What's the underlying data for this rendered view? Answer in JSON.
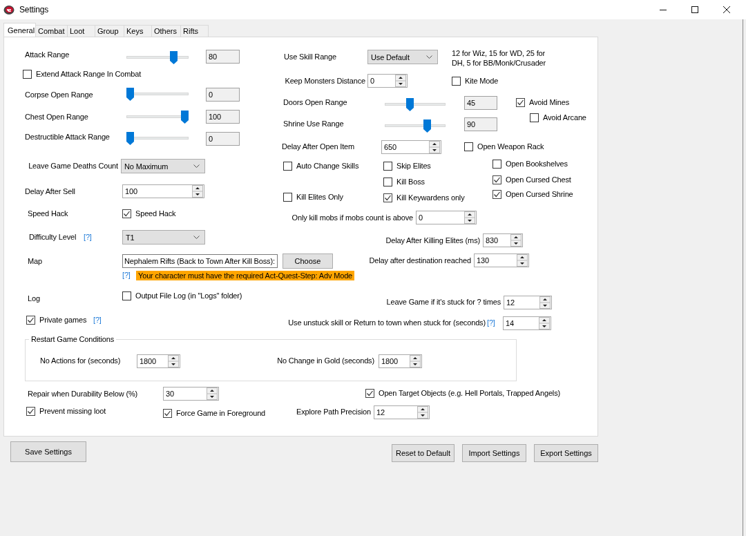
{
  "window": {
    "title": "Settings"
  },
  "tabs": [
    {
      "label": "General",
      "selected": true
    },
    {
      "label": "Combat",
      "selected": false
    },
    {
      "label": "Loot",
      "selected": false
    },
    {
      "label": "Group",
      "selected": false
    },
    {
      "label": "Keys",
      "selected": false
    },
    {
      "label": "Others",
      "selected": false
    },
    {
      "label": "Rifts",
      "selected": false
    }
  ],
  "left_controls": [
    {
      "kind": "label",
      "text": "Attack Range"
    },
    {
      "kind": "slider",
      "level": 0.8
    },
    {
      "kind": "readout",
      "value": "80"
    },
    {
      "kind": "checkbox",
      "label": "Extend Attack Range In Combat",
      "checked": false
    },
    {
      "kind": "label",
      "text": "Corpse Open Range"
    },
    {
      "kind": "slider",
      "level": 0
    },
    {
      "kind": "readout",
      "value": "0"
    },
    {
      "kind": "label",
      "text": "Chest Open Range"
    },
    {
      "kind": "slider",
      "level": 1
    },
    {
      "kind": "readout",
      "value": "100"
    },
    {
      "kind": "label",
      "text": "Destructible Attack Range"
    },
    {
      "kind": "slider",
      "level": 0
    },
    {
      "kind": "readout",
      "value": "0"
    },
    {
      "kind": "label",
      "text": "Leave Game Deaths Count"
    },
    {
      "kind": "dropdown",
      "value": "No Maximum"
    },
    {
      "kind": "label",
      "text": "Delay After Sell"
    },
    {
      "kind": "spin",
      "value": "100"
    },
    {
      "kind": "label",
      "text": "Speed Hack"
    },
    {
      "kind": "checkbox",
      "label": "Speed Hack",
      "checked": true
    },
    {
      "kind": "label",
      "text": "Difficulty Level"
    },
    {
      "kind": "help",
      "text": "[?]"
    },
    {
      "kind": "dropdown",
      "value": "T1"
    },
    {
      "kind": "label",
      "text": "Map"
    },
    {
      "kind": "textbox",
      "value": "Nephalem Rifts (Back to Town After Kill Boss):"
    },
    {
      "kind": "button",
      "label": "Choose"
    },
    {
      "kind": "help",
      "text": "[?]"
    },
    {
      "kind": "warning",
      "text": "Your character must have the required Act-Quest-Step: Adv Mode"
    },
    {
      "kind": "label",
      "text": "Log"
    },
    {
      "kind": "checkbox",
      "label": "Output File Log (in \"Logs\" folder)",
      "checked": false
    },
    {
      "kind": "checkbox",
      "label": "Private games",
      "checked": true
    },
    {
      "kind": "help",
      "text": "[?]"
    }
  ],
  "right_controls": [
    {
      "kind": "label",
      "text": "Use Skill Range"
    },
    {
      "kind": "dropdown",
      "value": "Use Default"
    },
    {
      "kind": "label",
      "text": "12 for Wiz, 15 for WD, 25 for DH,  5 for BB/Monk/Crusader"
    },
    {
      "kind": "label",
      "text": "Keep Monsters Distance"
    },
    {
      "kind": "spin",
      "value": "0"
    },
    {
      "kind": "checkbox",
      "label": "Kite Mode",
      "checked": false
    },
    {
      "kind": "label",
      "text": "Doors Open Range"
    },
    {
      "kind": "slider",
      "level": 0.4
    },
    {
      "kind": "readout",
      "value": "45"
    },
    {
      "kind": "checkbox",
      "label": "Avoid Mines",
      "checked": true
    },
    {
      "kind": "label",
      "text": "Shrine Use Range"
    },
    {
      "kind": "slider",
      "level": 0.73
    },
    {
      "kind": "readout",
      "value": "90"
    },
    {
      "kind": "checkbox",
      "label": "Avoid Arcane",
      "checked": false
    },
    {
      "kind": "label",
      "text": "Delay After Open Item"
    },
    {
      "kind": "spin",
      "value": "650"
    },
    {
      "kind": "checkbox",
      "label": "Open Weapon Rack",
      "checked": false
    },
    {
      "kind": "checkbox",
      "label": "Auto Change Skills",
      "checked": false
    },
    {
      "kind": "checkbox",
      "label": "Skip Elites",
      "checked": false
    },
    {
      "kind": "checkbox",
      "label": "Open Bookshelves",
      "checked": false
    },
    {
      "kind": "checkbox",
      "label": "Kill Boss",
      "checked": false
    },
    {
      "kind": "checkbox",
      "label": "Open Cursed Chest",
      "checked": true
    },
    {
      "kind": "checkbox",
      "label": "Kill Elites Only",
      "checked": false
    },
    {
      "kind": "checkbox",
      "label": "Kill Keywardens only",
      "checked": true
    },
    {
      "kind": "checkbox",
      "label": "Open Cursed Shrine",
      "checked": true
    },
    {
      "kind": "label",
      "text": "Only kill mobs if mobs count is above"
    },
    {
      "kind": "spin",
      "value": "0"
    },
    {
      "kind": "label",
      "text": "Delay After Killing Elites (ms)"
    },
    {
      "kind": "spin",
      "value": "830"
    },
    {
      "kind": "label",
      "text": "Delay after destination reached"
    },
    {
      "kind": "spin",
      "value": "130"
    },
    {
      "kind": "label",
      "text": "Leave Game if it's stuck for ? times"
    },
    {
      "kind": "spin",
      "value": "12"
    },
    {
      "kind": "label",
      "text": "Use unstuck skill or Return to town when stuck for (seconds)"
    },
    {
      "kind": "help",
      "text": "[?]"
    },
    {
      "kind": "spin",
      "value": "14"
    }
  ],
  "restart_group": {
    "kind": "group",
    "title": "Restart Game Conditions",
    "controls": [
      {
        "kind": "label",
        "text": "No Actions for (seconds)"
      },
      {
        "kind": "spin",
        "value": "1800"
      },
      {
        "kind": "label",
        "text": "No Change in Gold (seconds)"
      },
      {
        "kind": "spin",
        "value": "1800"
      }
    ]
  },
  "bottom_controls": [
    {
      "kind": "label",
      "text": "Repair when Durability Below (%)"
    },
    {
      "kind": "spin",
      "value": "30"
    },
    {
      "kind": "checkbox",
      "label": "Open Target Objects (e.g. Hell Portals, Trapped Angels)",
      "checked": true
    },
    {
      "kind": "checkbox",
      "label": "Prevent missing loot",
      "checked": true
    },
    {
      "kind": "checkbox",
      "label": "Force Game in Foreground",
      "checked": true
    },
    {
      "kind": "label",
      "text": "Explore Path Precision"
    },
    {
      "kind": "spin",
      "value": "12"
    }
  ],
  "footer_buttons": [
    {
      "label": "Save Settings"
    },
    {
      "label": "Reset to Default"
    },
    {
      "label": "Import Settings"
    },
    {
      "label": "Export Settings"
    }
  ]
}
